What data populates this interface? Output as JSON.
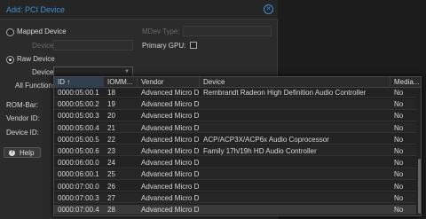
{
  "dialog": {
    "title": "Add: PCI Device",
    "mapped_device_label": "Mapped Device",
    "mapped_device_field_label": "Device:",
    "mdev_type_label": "MDev Type:",
    "primary_gpu_label": "Primary GPU:",
    "raw_device_label": "Raw Device",
    "raw_device_field_label": "Device:",
    "all_functions_label": "All Functions:",
    "rom_bar_label": "ROM-Bar:",
    "vendor_id_label": "Vendor ID:",
    "device_id_label": "Device ID:",
    "help_label": "Help",
    "selected_mode": "raw"
  },
  "grid": {
    "columns": [
      "ID ↑",
      "IOMM...",
      "Vendor",
      "Device",
      "Media..."
    ],
    "rows": [
      {
        "id": "0000:05:00.1",
        "iommu": "18",
        "vendor": "Advanced Micro D...",
        "device": "Rembrandt Radeon High Definition Audio Controller",
        "media": "No"
      },
      {
        "id": "0000:05:00.2",
        "iommu": "19",
        "vendor": "Advanced Micro D...",
        "device": "",
        "media": "No"
      },
      {
        "id": "0000:05:00.3",
        "iommu": "20",
        "vendor": "Advanced Micro D...",
        "device": "",
        "media": "No"
      },
      {
        "id": "0000:05:00.4",
        "iommu": "21",
        "vendor": "Advanced Micro D...",
        "device": "",
        "media": "No"
      },
      {
        "id": "0000:05:00.5",
        "iommu": "22",
        "vendor": "Advanced Micro D...",
        "device": "ACP/ACP3X/ACP6x Audio Coprocessor",
        "media": "No"
      },
      {
        "id": "0000:05:00.6",
        "iommu": "23",
        "vendor": "Advanced Micro D...",
        "device": "Family 17h/19h HD Audio Controller",
        "media": "No"
      },
      {
        "id": "0000:06:00.0",
        "iommu": "24",
        "vendor": "Advanced Micro D...",
        "device": "",
        "media": "No"
      },
      {
        "id": "0000:06:00.1",
        "iommu": "25",
        "vendor": "Advanced Micro D...",
        "device": "",
        "media": "No"
      },
      {
        "id": "0000:07:00.0",
        "iommu": "26",
        "vendor": "Advanced Micro D...",
        "device": "",
        "media": "No"
      },
      {
        "id": "0000:07:00.3",
        "iommu": "27",
        "vendor": "Advanced Micro D...",
        "device": "",
        "media": "No"
      },
      {
        "id": "0000:07:00.4",
        "iommu": "28",
        "vendor": "Advanced Micro D...",
        "device": "",
        "media": "No"
      }
    ]
  },
  "icons": {
    "close": "close-icon",
    "help": "help-icon",
    "dropdown": "chevron-down-icon"
  },
  "colors": {
    "accent": "#3d8fd6",
    "background": "#2b2b2b"
  }
}
